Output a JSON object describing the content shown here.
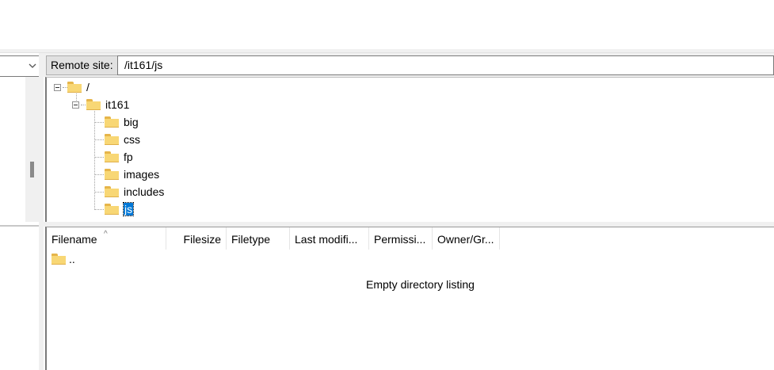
{
  "remote": {
    "label": "Remote site:",
    "path": "/it161/js"
  },
  "tree": {
    "root": "/",
    "child": "it161",
    "folders": [
      "big",
      "css",
      "fp",
      "images",
      "includes"
    ],
    "selected": "js"
  },
  "list": {
    "columns": [
      "Filename",
      "Filesize",
      "Filetype",
      "Last modifi...",
      "Permissi...",
      "Owner/Gr..."
    ],
    "sort_indicator": "^",
    "parent_entry": "..",
    "empty_message": "Empty directory listing"
  },
  "icons": {
    "folder": "folder-icon",
    "expander": "collapse-icon",
    "dropdown": "chevron-down-icon"
  },
  "colors": {
    "selection": "#0078d7",
    "folder": "#f8d775"
  }
}
